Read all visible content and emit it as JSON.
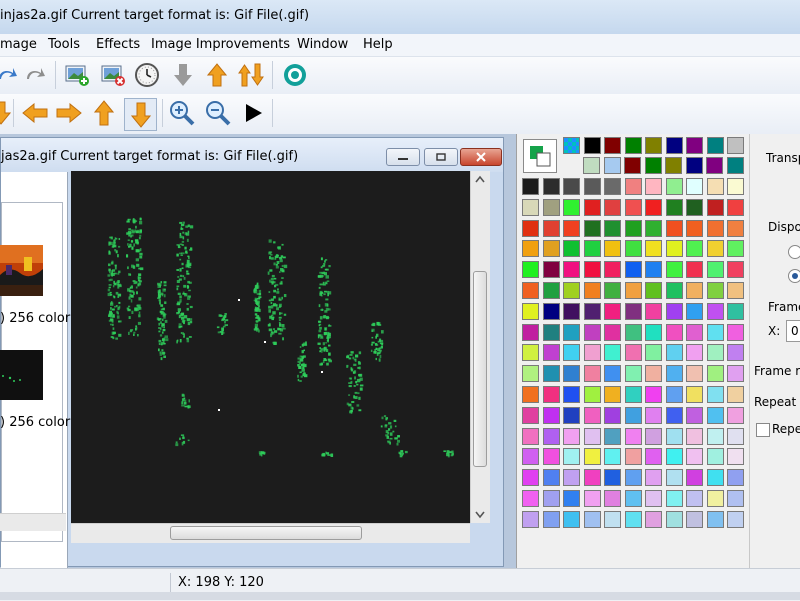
{
  "window": {
    "title": "injas2a.gif  Current target format is: Gif File(.gif)"
  },
  "menu": [
    "mage",
    "Tools",
    "Effects",
    "Image Improvements",
    "Window",
    "Help"
  ],
  "document": {
    "title": "jas2a.gif  Current target format is: Gif File(.gif)",
    "thumbnails": [
      {
        "label": ") 256 color"
      },
      {
        "label": ") 256 color"
      }
    ]
  },
  "toolbar_icons": {
    "row1": [
      "redo-icon",
      "redo-icon",
      "add-image-icon",
      "remove-image-icon",
      "timer-icon",
      "move-down-icon",
      "move-up-icon",
      "swap-icon",
      "preview-icon"
    ],
    "row2": [
      "move-down-icon",
      "arrow-left-icon",
      "arrow-right-icon",
      "arrow-up-icon",
      "arrow-down-icon",
      "zoom-in-icon",
      "zoom-out-icon",
      "play-icon"
    ]
  },
  "right_panel": {
    "transparency": "Transp",
    "disposal": "Dispos",
    "frame_position": "Frame",
    "x_label": "X:",
    "x_value": "0",
    "frame_rate": "Frame ra",
    "repeat": "Repeat c",
    "repeat_checkbox": "Repe"
  },
  "status": {
    "coordinates": "X: 198 Y: 120"
  },
  "colors": {
    "accent": "#16a34a",
    "canvas": "#1c1c1c",
    "sprite": "#2ecc5a"
  },
  "palette_top": [
    "#00c0c0",
    "#000000",
    "#800000",
    "#008000",
    "#808000",
    "#000080",
    "#800080",
    "#008080",
    "#c0c0c0",
    "#c0dcc0",
    "#a6caf0",
    "#800000",
    "#008000",
    "#808000",
    "#000080",
    "#800080",
    "#008080"
  ],
  "palette_rows": [
    [
      "#1c1c1c",
      "#2d2d2d",
      "#4a4a4a",
      "#5a5a5a",
      "#6a6a6a",
      "#f08080",
      "#ffb6c1",
      "#90ee90",
      "#e0ffff",
      "#f5deb3",
      "#fafad2"
    ],
    [
      "#d8d8b8",
      "#a0a080",
      "#30f030",
      "#e02020",
      "#e04040",
      "#f05050",
      "#f02020",
      "#208020",
      "#206020",
      "#c02020",
      "#f04040"
    ],
    [
      "#e03010",
      "#e04030",
      "#f04020",
      "#207020",
      "#209030",
      "#20a020",
      "#30b030",
      "#f05020",
      "#f06020",
      "#f07030",
      "#f08040"
    ],
    [
      "#f0a010",
      "#e0a020",
      "#10c030",
      "#20d040",
      "#f0c010",
      "#40e040",
      "#f0e020",
      "#e0f020",
      "#50f050",
      "#f0d030",
      "#60f060"
    ],
    [
      "#20f020",
      "#800040",
      "#f01080",
      "#f01040",
      "#f02060",
      "#1060f0",
      "#2080f0",
      "#40f040",
      "#f03050",
      "#50f070",
      "#f04060"
    ],
    [
      "#f06020",
      "#20a040",
      "#a0d020",
      "#f08020",
      "#40b040",
      "#f0a040",
      "#60c020",
      "#20c060",
      "#f0b060",
      "#80d040",
      "#f0c080"
    ],
    [
      "#e0f020",
      "#000080",
      "#401060",
      "#502070",
      "#f02080",
      "#803080",
      "#f040a0",
      "#a040f0",
      "#30a0f0",
      "#c050f0",
      "#30c0a0"
    ],
    [
      "#c020a0",
      "#208080",
      "#20a0c0",
      "#c040c0",
      "#e030a0",
      "#40c080",
      "#20e0c0",
      "#f050c0",
      "#e060d0",
      "#60e0f0",
      "#f060e0"
    ],
    [
      "#d0f040",
      "#c040d0",
      "#40d0f0",
      "#f0a0d0",
      "#40f0d0",
      "#f070b0",
      "#80f0a0",
      "#60d0f0",
      "#f0a0f0",
      "#a0f0c0",
      "#c080f0"
    ],
    [
      "#b0f080",
      "#2090b0",
      "#3080d0",
      "#f080a0",
      "#4090f0",
      "#80f0b0",
      "#f0b0a0",
      "#50b0f0",
      "#f0c0b0",
      "#a0f080",
      "#e0a0f0"
    ],
    [
      "#f07020",
      "#f03080",
      "#2050f0",
      "#a0f040",
      "#f0b020",
      "#30d0c0",
      "#f040f0",
      "#60a0f0",
      "#f0e060",
      "#80e0f0",
      "#f0d0a0"
    ],
    [
      "#e040a0",
      "#c030f0",
      "#2040c0",
      "#f060c0",
      "#a040e0",
      "#40a0e0",
      "#e080f0",
      "#4060f0",
      "#c060e0",
      "#50c0f0",
      "#f0a0e0"
    ],
    [
      "#f070c0",
      "#b060f0",
      "#f0a0f0",
      "#e0c0f0",
      "#50a0c0",
      "#f080f0",
      "#d0a0e0",
      "#a0e0f0",
      "#f0c0e0",
      "#c0f0f0",
      "#e0e0f0"
    ],
    [
      "#d060f0",
      "#f050e0",
      "#a0f0f0",
      "#f0f040",
      "#60f0f0",
      "#f0a0a0",
      "#e060f0",
      "#40f0f0",
      "#f0c0f0",
      "#a0f0e0",
      "#f0e0f0"
    ],
    [
      "#e040f0",
      "#5080f0",
      "#c0a0f0",
      "#f040c0",
      "#2060e0",
      "#60a0f0",
      "#e0a0f0",
      "#b0e0f0",
      "#d040e0",
      "#40e0f0",
      "#90a0f0"
    ],
    [
      "#f060f0",
      "#a0a0f0",
      "#3080f0",
      "#f0a0f0",
      "#e080e0",
      "#60c0f0",
      "#e0c0f0",
      "#80f0f0",
      "#c0c0f0",
      "#f0f0a0",
      "#b0c0f0"
    ],
    [
      "#c0a0f0",
      "#80a0f0",
      "#40c0f0",
      "#a0c0f0",
      "#c0e0f0",
      "#60e0f0",
      "#e0a0e0",
      "#a0e0e0",
      "#c0c0e0",
      "#80c0f0",
      "#c0d0f0"
    ]
  ]
}
